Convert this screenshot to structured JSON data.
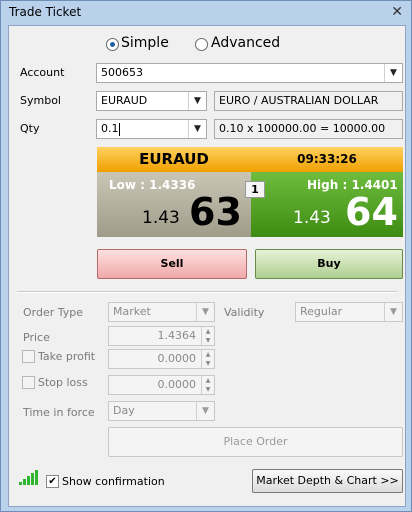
{
  "window": {
    "title": "Trade Ticket",
    "close_glyph": "✕"
  },
  "mode": {
    "simple_label": "Simple",
    "advanced_label": "Advanced",
    "selected": "Simple"
  },
  "account": {
    "label": "Account",
    "value": "500653"
  },
  "symbol": {
    "label": "Symbol",
    "value": "EURAUD",
    "description": "EURO / AUSTRALIAN DOLLAR"
  },
  "qty": {
    "label": "Qty",
    "value": "0.1",
    "calculation": "0.10 x 100000.00 = 10000.00"
  },
  "quote": {
    "symbol": "EURAUD",
    "time": "09:33:26",
    "low_label": "Low : 1.4336",
    "high_label": "High : 1.4401",
    "spread": "1",
    "sell_prefix": "1.43",
    "sell_big": "63",
    "buy_prefix": "1.43",
    "buy_big": "64"
  },
  "actions": {
    "sell_label": "Sell",
    "buy_label": "Buy"
  },
  "order": {
    "type_label": "Order Type",
    "type_value": "Market",
    "validity_label": "Validity",
    "validity_value": "Regular",
    "price_label": "Price",
    "price_value": "1.4364",
    "take_profit_label": "Take profit",
    "take_profit_value": "0.0000",
    "stop_loss_label": "Stop loss",
    "stop_loss_value": "0.0000",
    "tif_label": "Time in force",
    "tif_value": "Day",
    "place_label": "Place Order"
  },
  "footer": {
    "show_confirmation_label": "Show confirmation",
    "show_confirmation_checked": true,
    "market_depth_label": "Market Depth & Chart >>"
  },
  "icons": {
    "dropdown": "▼",
    "spin_up": "▲",
    "spin_down": "▼",
    "check": "✔"
  },
  "colors": {
    "header_orange": "#f5b000",
    "sell_panel": "#b3af9c",
    "buy_panel": "#4a9a1c",
    "sell_button": "#f4b8b8",
    "buy_button": "#c3dea8",
    "signal": "#2fb52f"
  }
}
